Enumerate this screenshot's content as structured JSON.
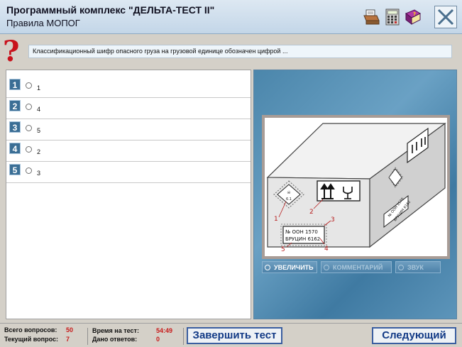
{
  "header": {
    "title": "Программный комплекс \"ДЕЛЬТА-ТЕСТ II\"",
    "subtitle": "Правила МОПОГ",
    "icons": [
      "printer-icon",
      "calculator-icon",
      "book-icon",
      "close-icon"
    ]
  },
  "question": {
    "text": "Классификационный шифр опасного груза на грузовой единице обозначен цифрой ..."
  },
  "answers": [
    {
      "num": "1",
      "text": "1"
    },
    {
      "num": "2",
      "text": "4"
    },
    {
      "num": "3",
      "text": "5"
    },
    {
      "num": "4",
      "text": "2"
    },
    {
      "num": "5",
      "text": "3"
    }
  ],
  "figure": {
    "callouts": [
      "1",
      "2",
      "3",
      "4",
      "5"
    ],
    "label_line1": "№ ООН    1570",
    "label_line2": "БРУЦИН   6162",
    "side_line1": "№ ООН  1570",
    "side_line2": "БРУЦИН  6162",
    "diamond_text": "6.1"
  },
  "pic_buttons": {
    "zoom": "УВЕЛИЧИТЬ",
    "comment": "КОММЕНТАРИЙ",
    "sound": "ЗВУК"
  },
  "status": {
    "total_label": "Всего вопросов:",
    "total_value": "50",
    "current_label": "Текущий вопрос:",
    "current_value": "7",
    "time_label": "Время на тест:",
    "time_value": "54:49",
    "answered_label": "Дано ответов:",
    "answered_value": "0"
  },
  "buttons": {
    "finish": "Завершить тест",
    "next": "Следующий"
  },
  "colors": {
    "accent": "#123a86",
    "qmark": "#c8121c",
    "status_value": "#c81a1a"
  }
}
